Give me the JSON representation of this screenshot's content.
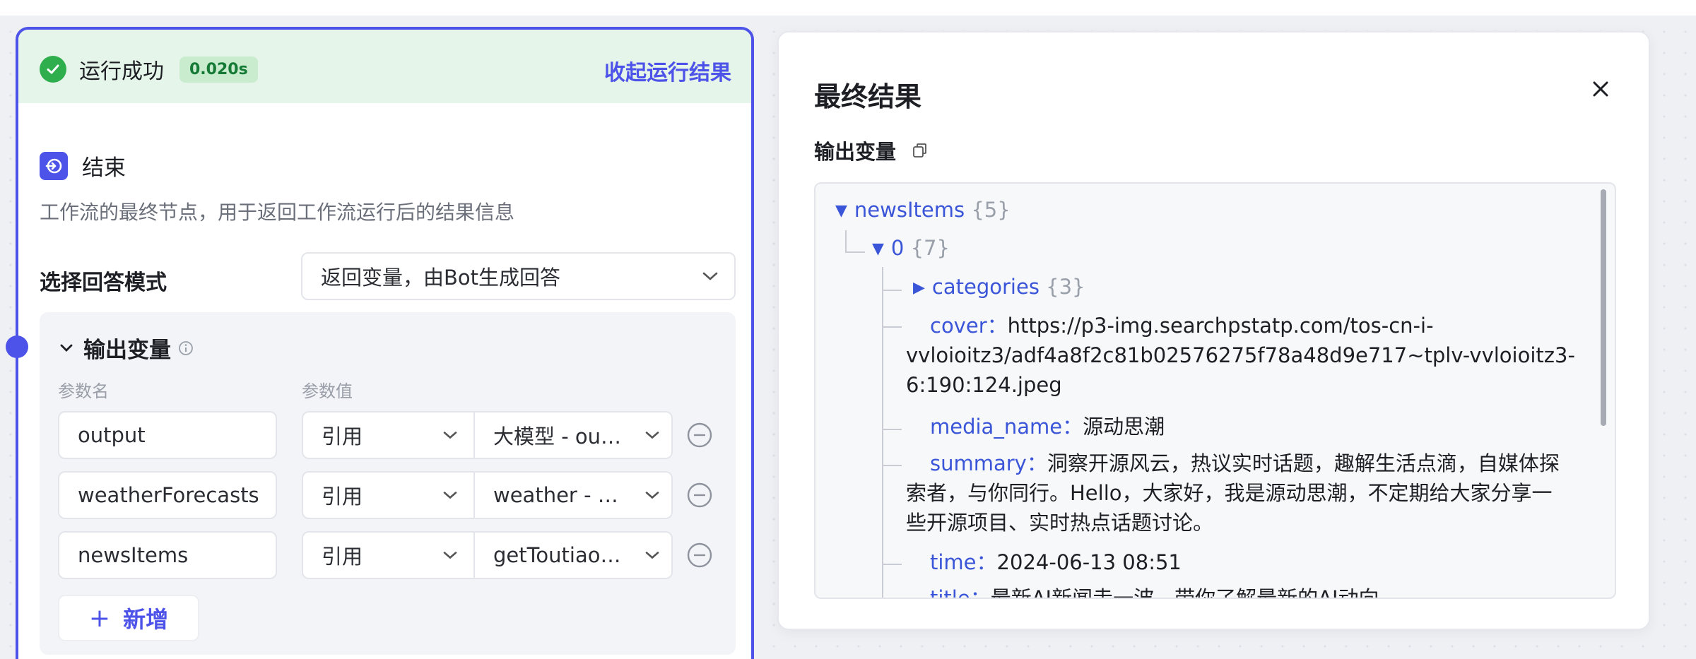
{
  "node": {
    "run_status": "运行成功",
    "run_time": "0.020s",
    "collapse_label": "收起运行结果",
    "title": "结束",
    "description": "工作流的最终节点，用于返回工作流运行后的结果信息",
    "mode_label": "选择回答模式",
    "mode_value": "返回变量，由Bot生成回答",
    "output_title": "输出变量",
    "col_name": "参数名",
    "col_value": "参数值",
    "rows": [
      {
        "name": "output",
        "ref": "引用",
        "value": "大模型 - out..."
      },
      {
        "name": "weatherForecasts",
        "ref": "引用",
        "value": "weather - d..."
      },
      {
        "name": "newsItems",
        "ref": "引用",
        "value": "getToutiaoNe"
      }
    ],
    "add_label": "新增",
    "add_plus": "+"
  },
  "result": {
    "title": "最终结果",
    "vars_label": "输出变量",
    "tree": {
      "root_key": "newsItems",
      "root_count": "{5}",
      "item_key": "0",
      "item_count": "{7}",
      "categories_key": "categories",
      "categories_count": "{3}",
      "cover_key": "cover",
      "cover_value_1": "https://p3-img.searchpstatp.com/tos-cn-i-",
      "cover_value_2": "vvloioitz3/adf4a8f2c81b02576275f78a48d9e717~tplv-vvloioitz3-",
      "cover_value_3": "6:190:124.jpeg",
      "media_key": "media_name",
      "media_value": "源动思潮",
      "summary_key": "summary",
      "summary_value_1": "洞察开源风云，热议实时话题，趣解生活点滴，自媒体探",
      "summary_value_2": "索者，与你同行。Hello，大家好，我是源动思潮，不定期给大家分享一",
      "summary_value_3": "些开源项目、实时热点话题讨论。",
      "time_key": "time",
      "time_value": "2024-06-13 08:51",
      "title_key": "title",
      "title_value": "最新AI新闻走一波，带你了解最新的AI动向"
    },
    "colon": "："
  },
  "colors": {
    "accent": "#4d53e8",
    "success": "#2fae4e",
    "success_bg": "#e6f5e9",
    "json_key": "#3a55d8"
  },
  "icons": [
    "check-circle-icon",
    "end-node-icon",
    "chevron-down-icon",
    "info-icon",
    "minus-circle-icon",
    "close-icon",
    "copy-icon",
    "caret-down-icon",
    "caret-right-icon"
  ]
}
